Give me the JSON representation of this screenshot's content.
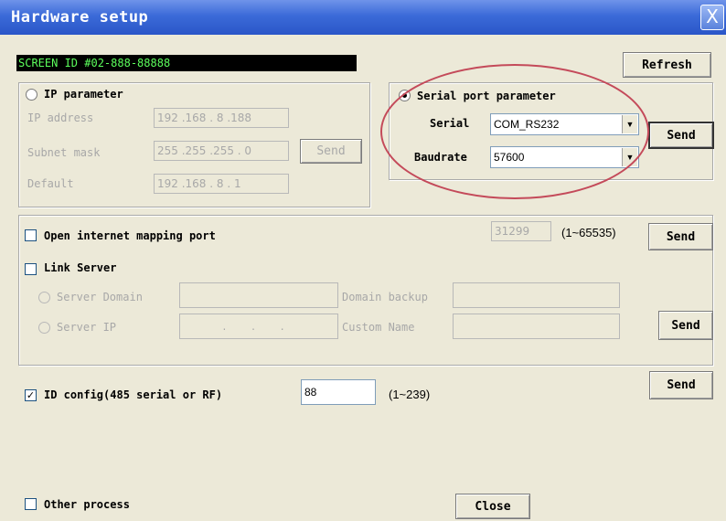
{
  "window": {
    "title": "Hardware setup",
    "close_glyph": "X"
  },
  "screen_id": {
    "text": "SCREEN ID #02-888-88888",
    "text_color": "#5dff5d",
    "background": "#000000"
  },
  "refresh_label": "Refresh",
  "ip_group": {
    "radio_label": "IP parameter",
    "selected": false,
    "fields": [
      {
        "label": "IP address",
        "value": "192 .168 . 8 .188"
      },
      {
        "label": "Subnet mask",
        "value": "255 .255 .255 . 0"
      },
      {
        "label": "Default",
        "value": "192 .168 . 8 . 1"
      }
    ],
    "send_label": "Send"
  },
  "serial_group": {
    "radio_label": "Serial port parameter",
    "selected": true,
    "serial_label": "Serial",
    "serial_value": "COM_RS232",
    "baud_label": "Baudrate",
    "baud_value": "57600",
    "send_label": "Send",
    "highlight_color": "#c44a5a"
  },
  "mapping": {
    "label": "Open internet mapping port",
    "checked": false,
    "port_value": "31299",
    "range": "(1~65535)",
    "send_label": "Send"
  },
  "link_server": {
    "label": "Link Server",
    "checked": false,
    "server_domain_label": "Server Domain",
    "server_ip_label": "Server IP",
    "ip_value": ". . .",
    "domain_backup_label": "Domain backup",
    "custom_name_label": "Custom Name",
    "send_label": "Send"
  },
  "id_config": {
    "label": "ID config(485 serial or RF)",
    "checked": true,
    "value": "88",
    "range": "(1~239)",
    "send_label": "Send"
  },
  "other_process": {
    "label": "Other process",
    "checked": false
  },
  "close_label": "Close"
}
